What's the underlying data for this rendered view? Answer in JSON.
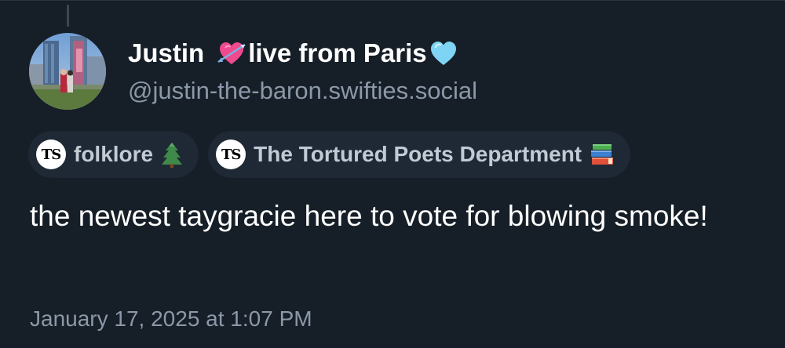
{
  "post": {
    "author": {
      "name": "Justin",
      "name_suffix": "live from Paris",
      "emoji_before_suffix": "cupid-heart-icon",
      "emoji_after_suffix": "light-blue-heart-icon",
      "handle": "@justin-the-baron.swifties.social"
    },
    "tags": [
      {
        "logo_text": "TS",
        "label": "folklore",
        "emoji": "evergreen-tree-icon"
      },
      {
        "logo_text": "TS",
        "label": "The Tortured Poets Department",
        "emoji": "books-icon"
      }
    ],
    "text": "the newest taygracie here to vote for blowing smoke!",
    "timestamp": "January 17, 2025 at 1:07 PM"
  },
  "colors": {
    "background": "#161e27",
    "secondary_text": "#8b98a8",
    "tag_background": "#1e2935",
    "tag_text": "#c1cad5"
  }
}
